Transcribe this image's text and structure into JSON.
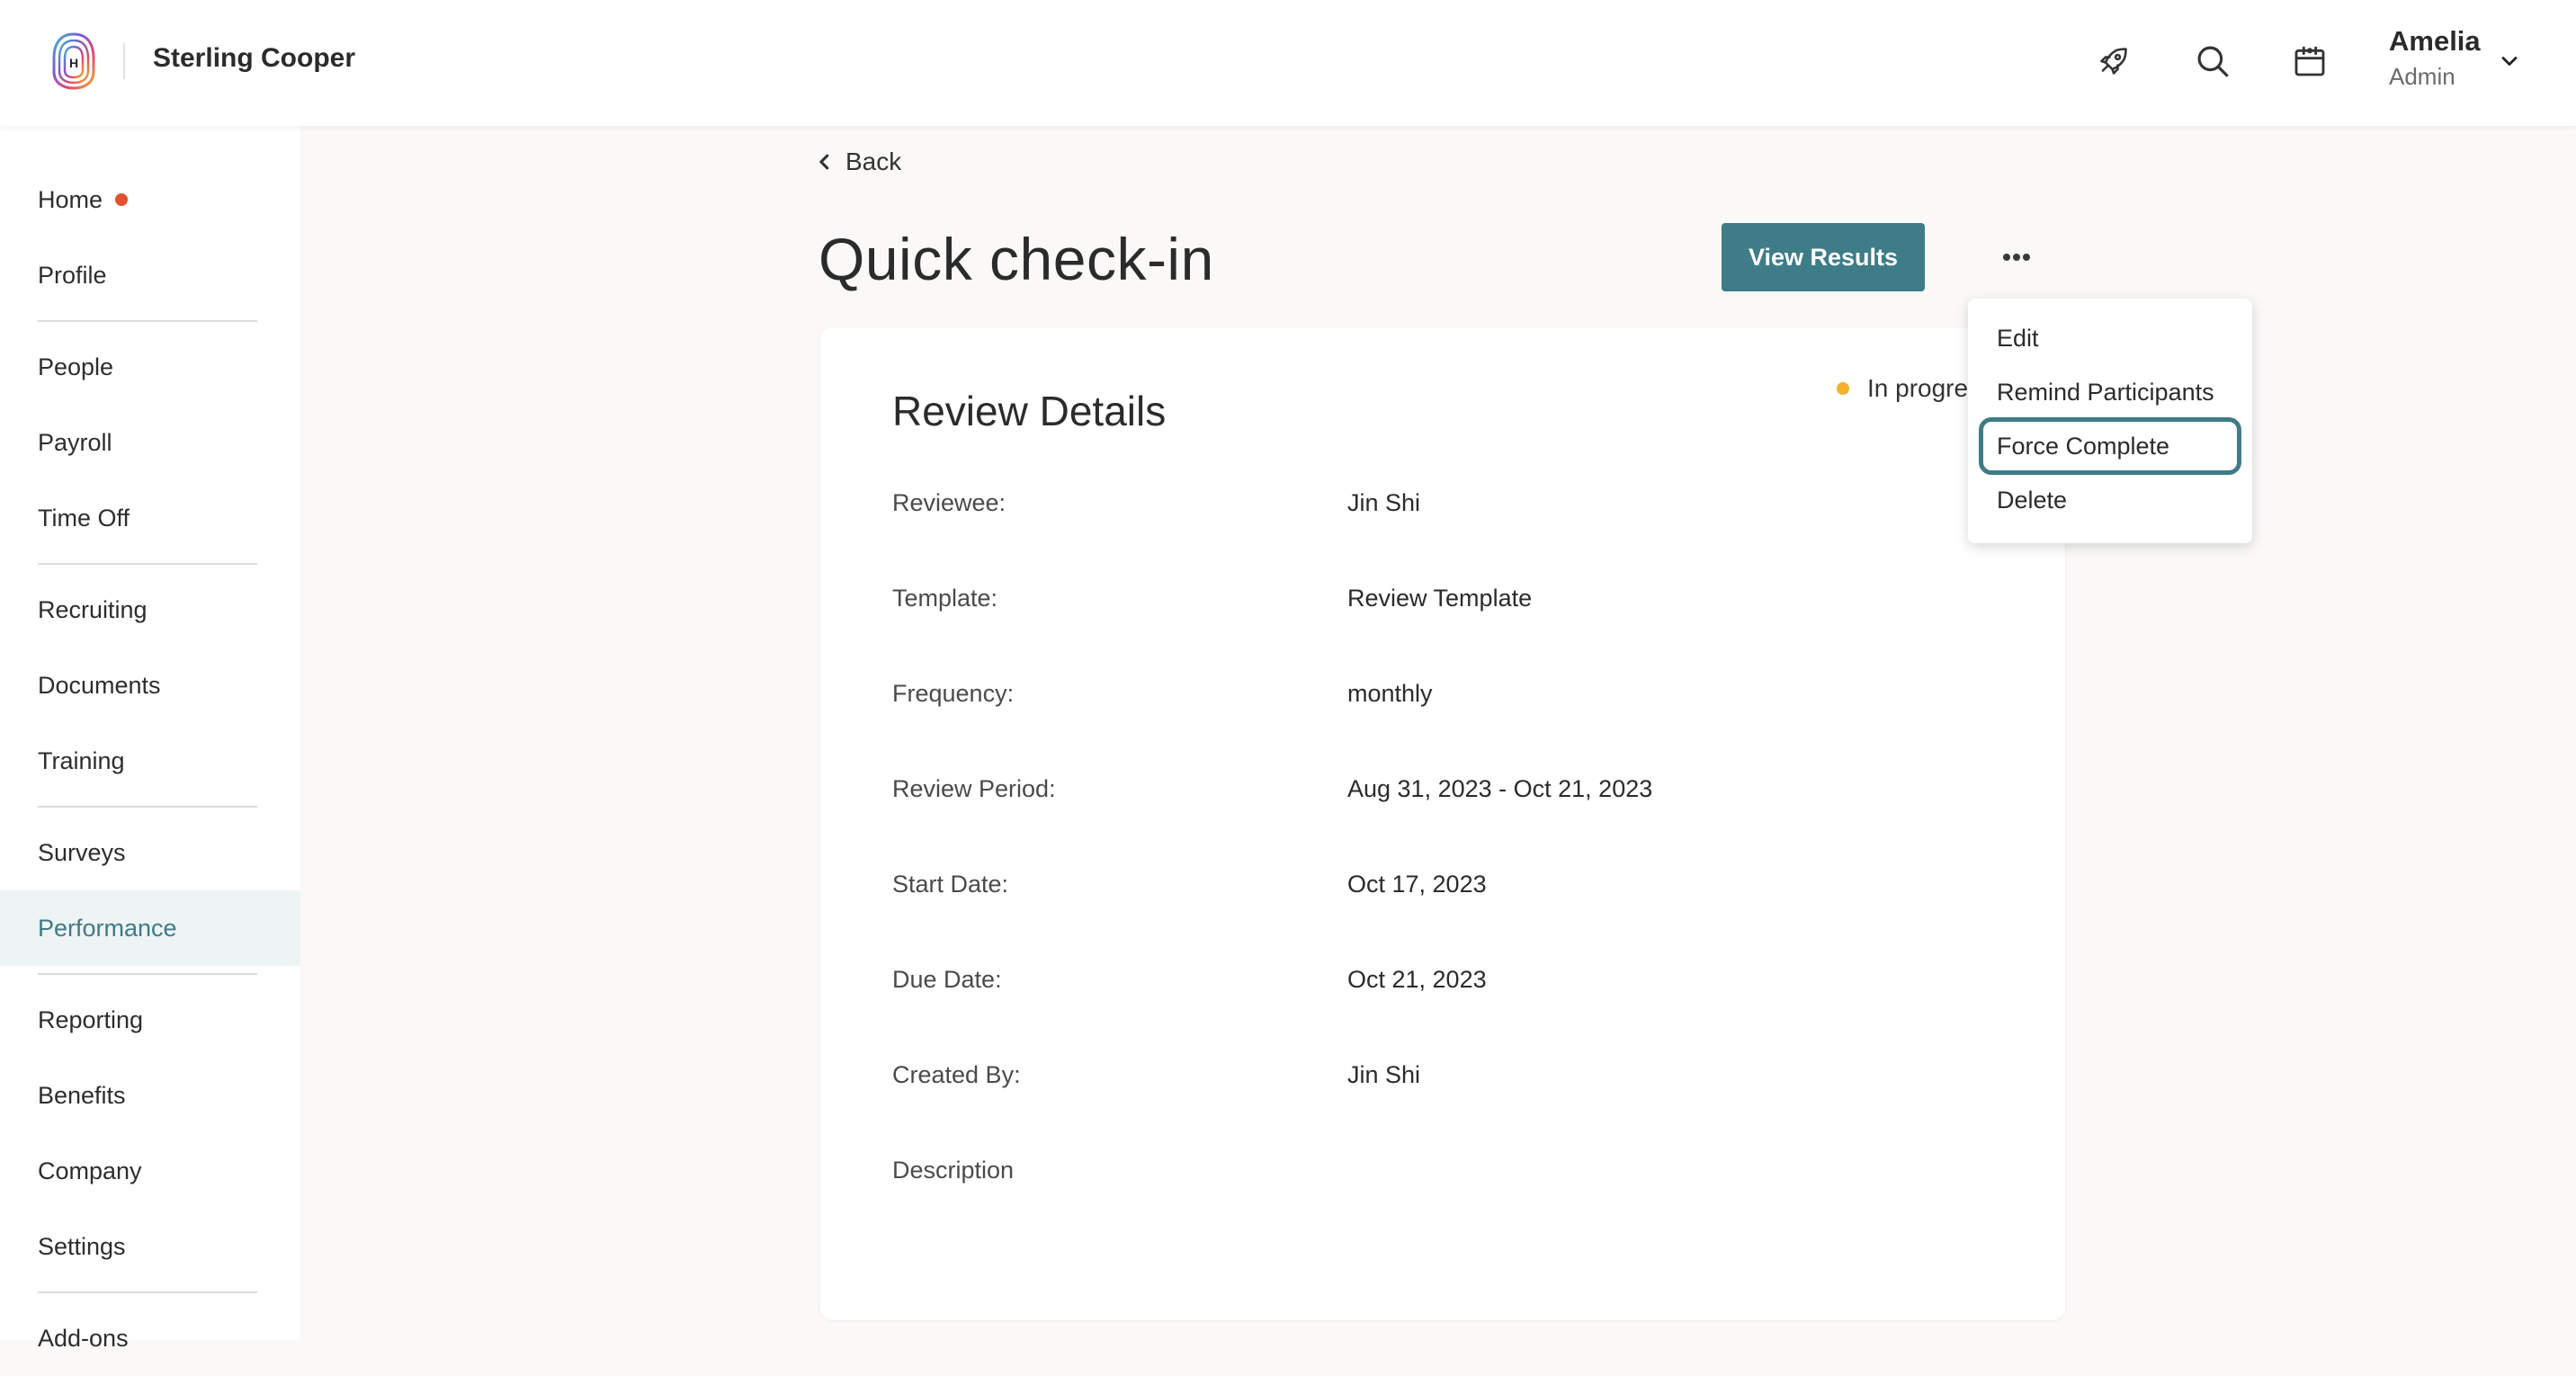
{
  "header": {
    "company_name": "Sterling Cooper",
    "logo_letter": "H",
    "user": {
      "name": "Amelia",
      "role": "Admin"
    },
    "icons": [
      "rocket-icon",
      "search-icon",
      "calendar-icon",
      "chevron-down-icon"
    ]
  },
  "sidebar": {
    "items": [
      {
        "label": "Home",
        "has_notification_dot": true
      },
      {
        "label": "Profile"
      },
      {
        "label": "People"
      },
      {
        "label": "Payroll"
      },
      {
        "label": "Time Off"
      },
      {
        "label": "Recruiting"
      },
      {
        "label": "Documents"
      },
      {
        "label": "Training"
      },
      {
        "label": "Surveys"
      },
      {
        "label": "Performance",
        "active": true
      },
      {
        "label": "Reporting"
      },
      {
        "label": "Benefits"
      },
      {
        "label": "Company"
      },
      {
        "label": "Settings"
      },
      {
        "label": "Add-ons"
      }
    ]
  },
  "main": {
    "back_label": "Back",
    "title": "Quick check-in",
    "view_results_label": "View Results",
    "card": {
      "title": "Review Details",
      "status": "In progress",
      "rows": [
        {
          "label": "Reviewee:",
          "value": "Jin Shi"
        },
        {
          "label": "Template:",
          "value": "Review Template"
        },
        {
          "label": "Frequency:",
          "value": "monthly"
        },
        {
          "label": "Review Period:",
          "value": "Aug 31, 2023 - Oct 21, 2023"
        },
        {
          "label": "Start Date:",
          "value": "Oct 17, 2023"
        },
        {
          "label": "Due Date:",
          "value": "Oct 21, 2023"
        },
        {
          "label": "Created By:",
          "value": "Jin Shi"
        },
        {
          "label": "Description",
          "value": ""
        }
      ]
    }
  },
  "menu": {
    "items": [
      {
        "label": "Edit"
      },
      {
        "label": "Remind Participants"
      },
      {
        "label": "Force Complete",
        "focused": true
      },
      {
        "label": "Delete"
      }
    ]
  },
  "colors": {
    "accent": "#3e7c87",
    "notification_dot": "#e1532c",
    "status_in_progress": "#f2b22c",
    "active_nav_bg": "#eef3f4"
  }
}
